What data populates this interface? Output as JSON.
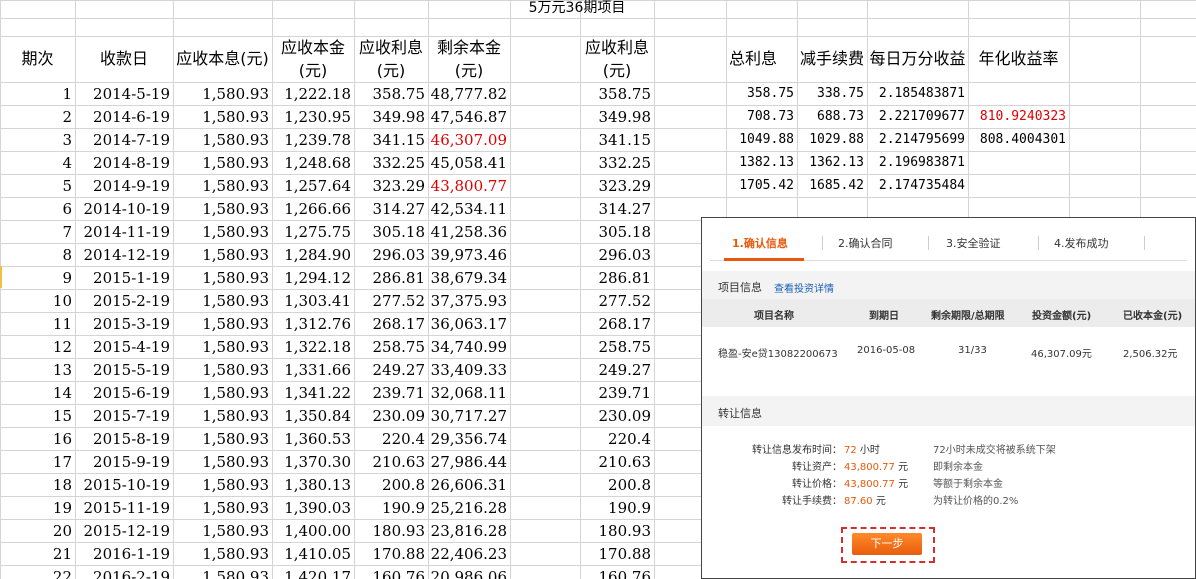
{
  "sheet": {
    "title": "5万元36期项目",
    "headers": {
      "period": "期次",
      "date": "收款日",
      "receivable_interest_total": "应收本息(元)",
      "principal_line1": "应收本金",
      "principal_line2": "(元)",
      "interest_line1": "应收利息",
      "interest_line2": "(元)",
      "remaining_line1": "剩余本金",
      "remaining_line2": "(元)",
      "interest2_line1": "应收利息",
      "interest2_line2": "(元)",
      "total_interest": "总利息",
      "minus_fee": "减手续费",
      "daily_yield": "每日万分收益",
      "annual_yield": "年化收益率"
    },
    "rows": [
      {
        "n": "1",
        "date": "2014-5-19",
        "total": "1,580.93",
        "principal": "1,222.18",
        "interest": "358.75",
        "remaining": "48,777.82",
        "remaining_red": false,
        "interest2": "358.75"
      },
      {
        "n": "2",
        "date": "2014-6-19",
        "total": "1,580.93",
        "principal": "1,230.95",
        "interest": "349.98",
        "remaining": "47,546.87",
        "remaining_red": false,
        "interest2": "349.98"
      },
      {
        "n": "3",
        "date": "2014-7-19",
        "total": "1,580.93",
        "principal": "1,239.78",
        "interest": "341.15",
        "remaining": "46,307.09",
        "remaining_red": true,
        "interest2": "341.15"
      },
      {
        "n": "4",
        "date": "2014-8-19",
        "total": "1,580.93",
        "principal": "1,248.68",
        "interest": "332.25",
        "remaining": "45,058.41",
        "remaining_red": false,
        "interest2": "332.25"
      },
      {
        "n": "5",
        "date": "2014-9-19",
        "total": "1,580.93",
        "principal": "1,257.64",
        "interest": "323.29",
        "remaining": "43,800.77",
        "remaining_red": true,
        "interest2": "323.29"
      },
      {
        "n": "6",
        "date": "2014-10-19",
        "total": "1,580.93",
        "principal": "1,266.66",
        "interest": "314.27",
        "remaining": "42,534.11",
        "remaining_red": false,
        "interest2": "314.27"
      },
      {
        "n": "7",
        "date": "2014-11-19",
        "total": "1,580.93",
        "principal": "1,275.75",
        "interest": "305.18",
        "remaining": "41,258.36",
        "remaining_red": false,
        "interest2": "305.18"
      },
      {
        "n": "8",
        "date": "2014-12-19",
        "total": "1,580.93",
        "principal": "1,284.90",
        "interest": "296.03",
        "remaining": "39,973.46",
        "remaining_red": false,
        "interest2": "296.03"
      },
      {
        "n": "9",
        "date": "2015-1-19",
        "total": "1,580.93",
        "principal": "1,294.12",
        "interest": "286.81",
        "remaining": "38,679.34",
        "remaining_red": false,
        "interest2": "286.81"
      },
      {
        "n": "10",
        "date": "2015-2-19",
        "total": "1,580.93",
        "principal": "1,303.41",
        "interest": "277.52",
        "remaining": "37,375.93",
        "remaining_red": false,
        "interest2": "277.52"
      },
      {
        "n": "11",
        "date": "2015-3-19",
        "total": "1,580.93",
        "principal": "1,312.76",
        "interest": "268.17",
        "remaining": "36,063.17",
        "remaining_red": false,
        "interest2": "268.17"
      },
      {
        "n": "12",
        "date": "2015-4-19",
        "total": "1,580.93",
        "principal": "1,322.18",
        "interest": "258.75",
        "remaining": "34,740.99",
        "remaining_red": false,
        "interest2": "258.75"
      },
      {
        "n": "13",
        "date": "2015-5-19",
        "total": "1,580.93",
        "principal": "1,331.66",
        "interest": "249.27",
        "remaining": "33,409.33",
        "remaining_red": false,
        "interest2": "249.27"
      },
      {
        "n": "14",
        "date": "2015-6-19",
        "total": "1,580.93",
        "principal": "1,341.22",
        "interest": "239.71",
        "remaining": "32,068.11",
        "remaining_red": false,
        "interest2": "239.71"
      },
      {
        "n": "15",
        "date": "2015-7-19",
        "total": "1,580.93",
        "principal": "1,350.84",
        "interest": "230.09",
        "remaining": "30,717.27",
        "remaining_red": false,
        "interest2": "230.09"
      },
      {
        "n": "16",
        "date": "2015-8-19",
        "total": "1,580.93",
        "principal": "1,360.53",
        "interest": "220.4",
        "remaining": "29,356.74",
        "remaining_red": false,
        "interest2": "220.4"
      },
      {
        "n": "17",
        "date": "2015-9-19",
        "total": "1,580.93",
        "principal": "1,370.30",
        "interest": "210.63",
        "remaining": "27,986.44",
        "remaining_red": false,
        "interest2": "210.63"
      },
      {
        "n": "18",
        "date": "2015-10-19",
        "total": "1,580.93",
        "principal": "1,380.13",
        "interest": "200.8",
        "remaining": "26,606.31",
        "remaining_red": false,
        "interest2": "200.8"
      },
      {
        "n": "19",
        "date": "2015-11-19",
        "total": "1,580.93",
        "principal": "1,390.03",
        "interest": "190.9",
        "remaining": "25,216.28",
        "remaining_red": false,
        "interest2": "190.9"
      },
      {
        "n": "20",
        "date": "2015-12-19",
        "total": "1,580.93",
        "principal": "1,400.00",
        "interest": "180.93",
        "remaining": "23,816.28",
        "remaining_red": false,
        "interest2": "180.93"
      },
      {
        "n": "21",
        "date": "2016-1-19",
        "total": "1,580.93",
        "principal": "1,410.05",
        "interest": "170.88",
        "remaining": "22,406.23",
        "remaining_red": false,
        "interest2": "170.88"
      },
      {
        "n": "22",
        "date": "2016-2-19",
        "total": "1,580.93",
        "principal": "1,420.17",
        "interest": "160.76",
        "remaining": "20,986.06",
        "remaining_red": false,
        "interest2": "160.76"
      }
    ],
    "side_rows": [
      {
        "total_interest": "358.75",
        "minus_fee": "338.75",
        "daily": "2.185483871",
        "annual": "",
        "annual_red": false
      },
      {
        "total_interest": "708.73",
        "minus_fee": "688.73",
        "daily": "2.221709677",
        "annual": "810.9240323",
        "annual_red": true
      },
      {
        "total_interest": "1049.88",
        "minus_fee": "1029.88",
        "daily": "2.214795699",
        "annual": "808.4004301",
        "annual_red": false
      },
      {
        "total_interest": "1382.13",
        "minus_fee": "1362.13",
        "daily": "2.196983871",
        "annual": "",
        "annual_red": false
      },
      {
        "total_interest": "1705.42",
        "minus_fee": "1685.42",
        "daily": "2.174735484",
        "annual": "",
        "annual_red": false
      }
    ]
  },
  "dialog": {
    "steps": [
      "1.确认信息",
      "2.确认合同",
      "3.安全验证",
      "4.发布成功"
    ],
    "project_section": {
      "title": "项目信息",
      "link": "查看投资详情",
      "columns": [
        "项目名称",
        "到期日",
        "剩余期限/总期限",
        "投资金额(元)",
        "已收本金(元)"
      ],
      "row": [
        "稳盈-安e贷13082200673",
        "2016-05-08",
        "31/33",
        "46,307.09元",
        "2,506.32元"
      ]
    },
    "transfer_section": {
      "title": "转让信息",
      "items": [
        {
          "label": "转让信息发布时间：",
          "value": "72",
          "unit": " 小时",
          "note": "72小时未成交将被系统下架"
        },
        {
          "label": "转让资产：",
          "value": "43,800.77",
          "unit": " 元",
          "note": "即剩余本金"
        },
        {
          "label": "转让价格：",
          "value": "43,800.77",
          "unit": " 元",
          "note": "等额于剩余本金"
        },
        {
          "label": "转让手续费：",
          "value": "87.60",
          "unit": " 元",
          "note": "为转让价格的0.2%"
        }
      ]
    },
    "next_button": "下一步",
    "colors": {
      "accent": "#e8590c",
      "red_text": "#e00000",
      "link": "#1a5fb4"
    }
  }
}
